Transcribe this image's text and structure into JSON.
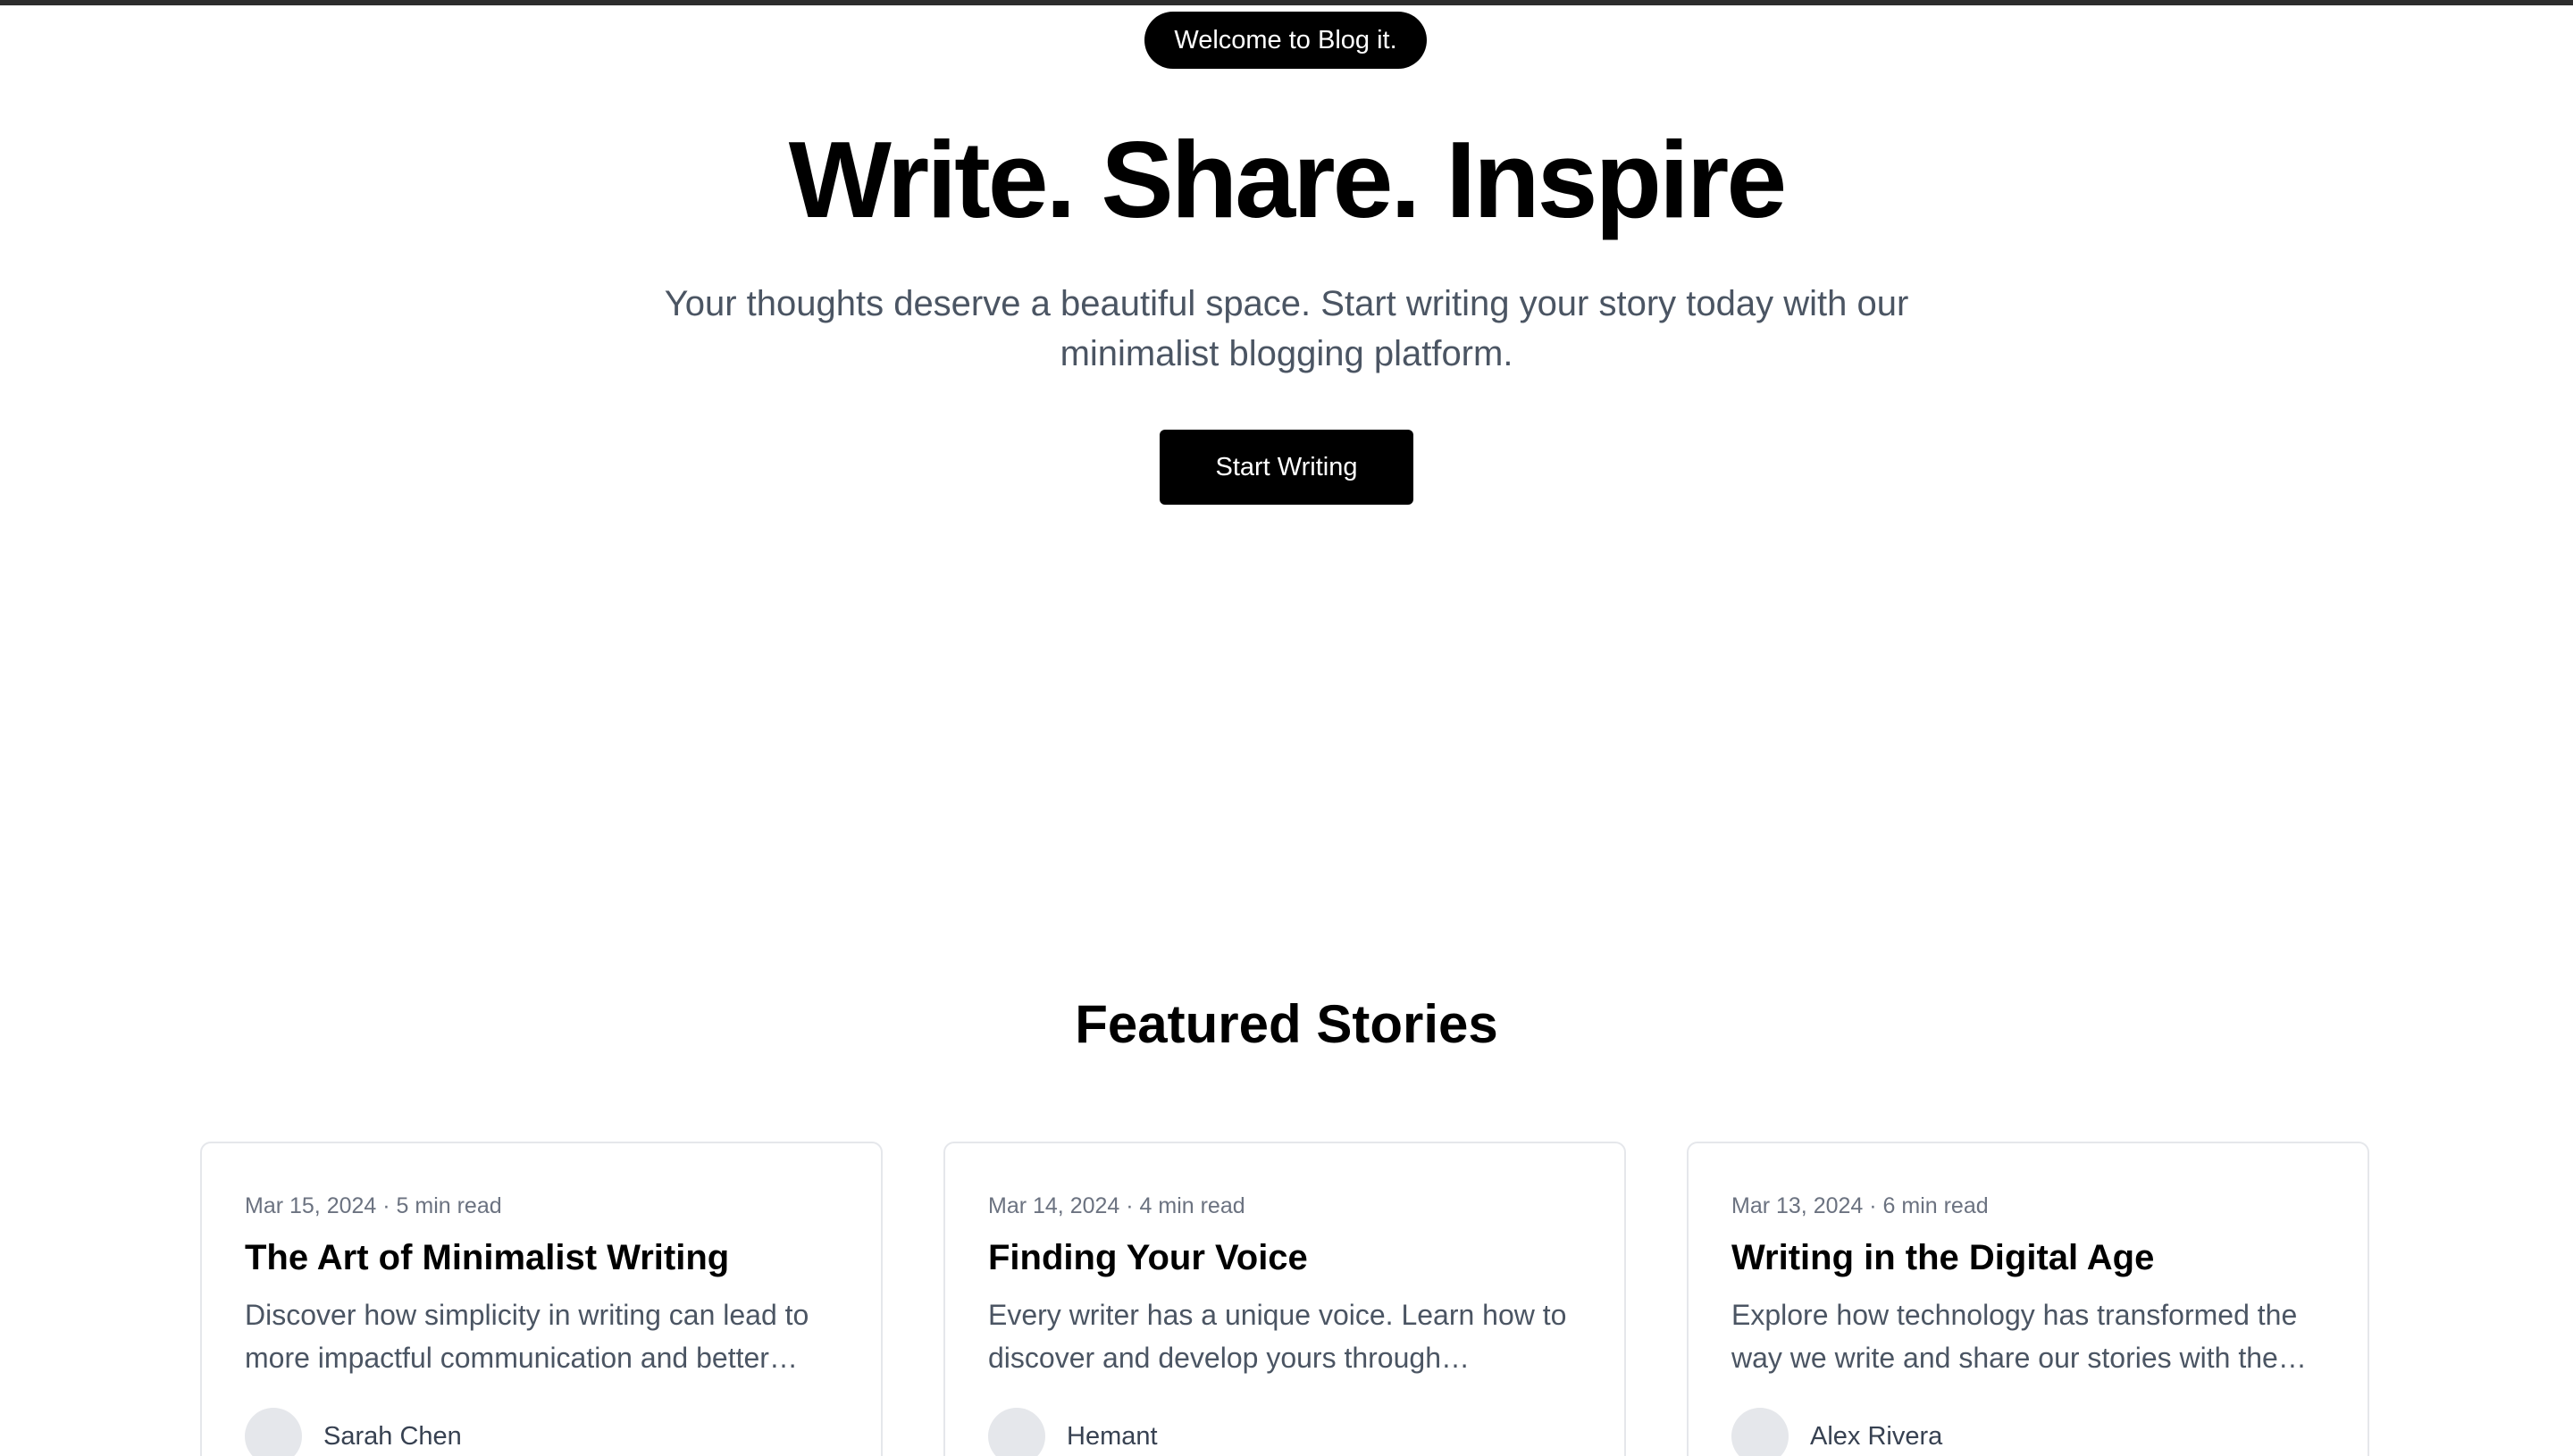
{
  "hero": {
    "badge": "Welcome to Blog it.",
    "title": "Write. Share. Inspire",
    "subtitle": "Your thoughts deserve a beautiful space. Start writing your story today with our minimalist blogging platform.",
    "cta_label": "Start Writing"
  },
  "featured": {
    "heading": "Featured Stories",
    "posts": [
      {
        "meta": "Mar 15, 2024 · 5 min read",
        "title": "The Art of Minimalist Writing",
        "excerpt": "Discover how simplicity in writing can lead to more impactful communication and better…",
        "author": "Sarah Chen"
      },
      {
        "meta": "Mar 14, 2024 · 4 min read",
        "title": "Finding Your Voice",
        "excerpt": "Every writer has a unique voice. Learn how to discover and develop yours through…",
        "author": "Hemant"
      },
      {
        "meta": "Mar 13, 2024 · 6 min read",
        "title": "Writing in the Digital Age",
        "excerpt": "Explore how technology has transformed the way we write and share our stories with the…",
        "author": "Alex Rivera"
      }
    ]
  }
}
